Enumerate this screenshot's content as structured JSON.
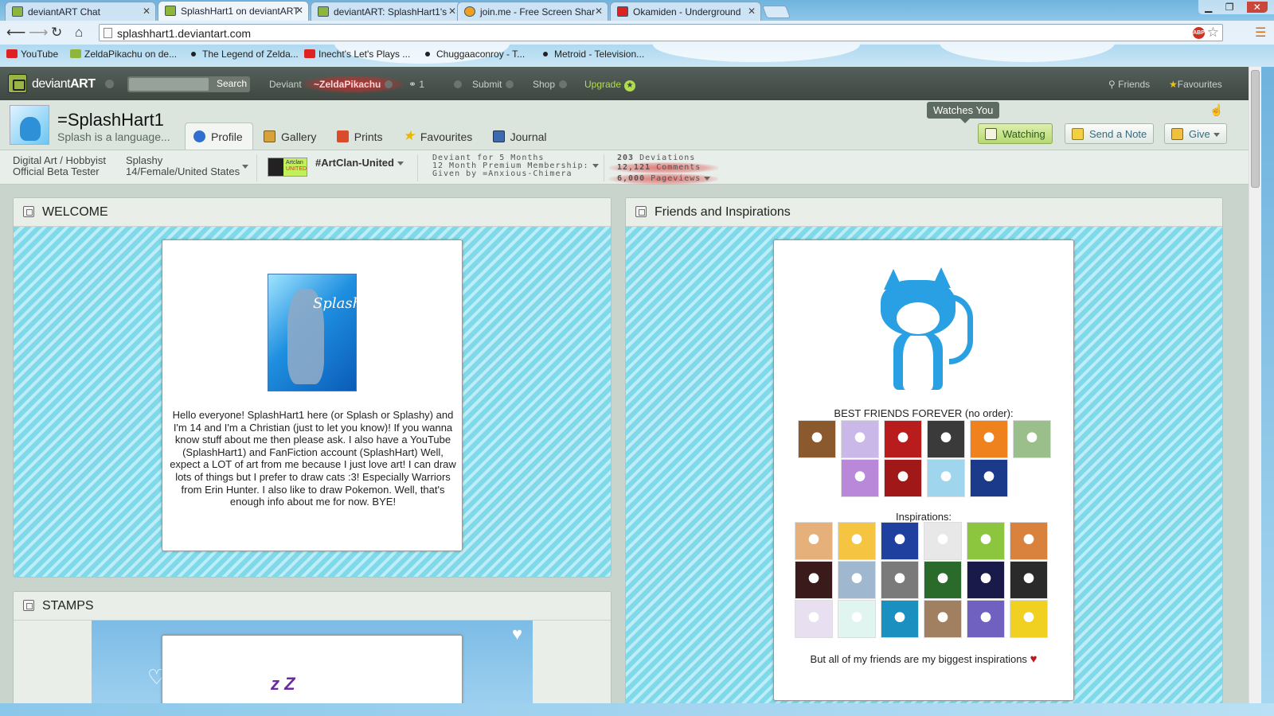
{
  "browser": {
    "tabs": [
      {
        "title": "deviantART Chat",
        "icon": "deviantart-favicon"
      },
      {
        "title": "SplashHart1 on deviantART",
        "icon": "deviantart-favicon",
        "active": true
      },
      {
        "title": "deviantART: SplashHart1's",
        "icon": "deviantart-favicon"
      },
      {
        "title": "join.me - Free Screen Shar",
        "icon": "joinme-favicon"
      },
      {
        "title": "Okamiden - Underground",
        "icon": "youtube-favicon"
      }
    ],
    "url": "splashhart1.deviantart.com",
    "adblock_label": "ABP",
    "bookmarks": [
      {
        "label": "YouTube",
        "icon": "youtube-favicon"
      },
      {
        "label": "ZeldaPikachu on de...",
        "icon": "deviantart-favicon"
      },
      {
        "label": "The Legend of Zelda...",
        "icon": "dot-favicon"
      },
      {
        "label": "Inecht's Let's Plays ...",
        "icon": "youtube-favicon"
      },
      {
        "label": "Chuggaaconroy - T...",
        "icon": "dot-favicon"
      },
      {
        "label": "Metroid - Television...",
        "icon": "dot-favicon"
      }
    ]
  },
  "deviantart_bar": {
    "brand_prefix": "deviant",
    "brand_suffix": "ART",
    "search_button": "Search",
    "deviant_label": "Deviant",
    "username": "~ZeldaPikachu",
    "watch_count": "1",
    "submit": "Submit",
    "shop": "Shop",
    "upgrade": "Upgrade",
    "friends": "Friends",
    "favourites": "Favourites"
  },
  "profile": {
    "name": "=SplashHart1",
    "tagline": "Splash is a language...",
    "tabs": [
      {
        "label": "Profile",
        "icon": "info-icon",
        "active": true
      },
      {
        "label": "Gallery",
        "icon": "gallery-icon"
      },
      {
        "label": "Prints",
        "icon": "prints-icon"
      },
      {
        "label": "Favourites",
        "icon": "star-icon"
      },
      {
        "label": "Journal",
        "icon": "journal-icon"
      }
    ],
    "watches_you_tooltip": "Watches You",
    "watching_button": "Watching",
    "send_note_button": "Send a Note",
    "give_button": "Give"
  },
  "stats": {
    "category_line1": "Digital Art / Hobbyist",
    "category_line2": "Official Beta Tester",
    "nick_line1": "Splashy",
    "nick_line2": "14/Female/United States",
    "group_badge_line1": "Artclan",
    "group_badge_line2": "UNITED",
    "group": "#ArtClan-United",
    "deviant_for": "Deviant for 5 Months",
    "membership": "12 Month Premium Membership:",
    "given_by": "Given by =Anxious-Chimera",
    "deviations_count": "203",
    "deviations_label": "Deviations",
    "comments_count": "12,121",
    "comments_label": "Comments",
    "pageviews_count": "6,000",
    "pageviews_label": "Pageviews"
  },
  "welcome": {
    "title": "WELCOME",
    "image_signature": "Splash",
    "text": "Hello everyone! SplashHart1 here (or Splash or Splashy) and I'm 14 and I'm a Christian (just to let you know)! If you wanna know stuff about me then please ask. I also have a YouTube (SplashHart1) and FanFiction account (SplashHart) Well, expect a LOT of art from me because I just love art! I can draw lots of things but I prefer to draw cats :3! Especially Warriors from Erin Hunter. I also like to draw Pokemon. Well, that's enough info about me for now. BYE!"
  },
  "stamps": {
    "title": "STAMPS",
    "partial_text": "z Z"
  },
  "friends": {
    "title": "Friends and Inspirations",
    "best_friends_label": "BEST FRIENDS FOREVER (no order):",
    "best_friends_colors": [
      "#8a5a2e",
      "#c9b8e8",
      "#b81c1c",
      "#3a3a3a",
      "#f0821e",
      "#9bbf8a",
      "#b988d8",
      "#a01818",
      "#9fd6ee",
      "#1b3a8a"
    ],
    "inspirations_label": "Inspirations:",
    "inspirations_colors": [
      "#e6b07a",
      "#f5c542",
      "#2040a0",
      "#e8e8e8",
      "#8cc63f",
      "#d9823e",
      "#3a1a1a",
      "#9fb8cf",
      "#7a7a7a",
      "#2a6a2a",
      "#1a1a4a",
      "#2a2a2a",
      "#e8e0f0",
      "#e0f4f0",
      "#1a90c0",
      "#a08060",
      "#7060c0",
      "#f0d020"
    ],
    "footer": "But all of my friends are my biggest inspirations"
  },
  "colors": {
    "da_bar": "#4a544d",
    "accent_green": "#b2dd4e",
    "panel_stripe": "#7fd9ea"
  }
}
